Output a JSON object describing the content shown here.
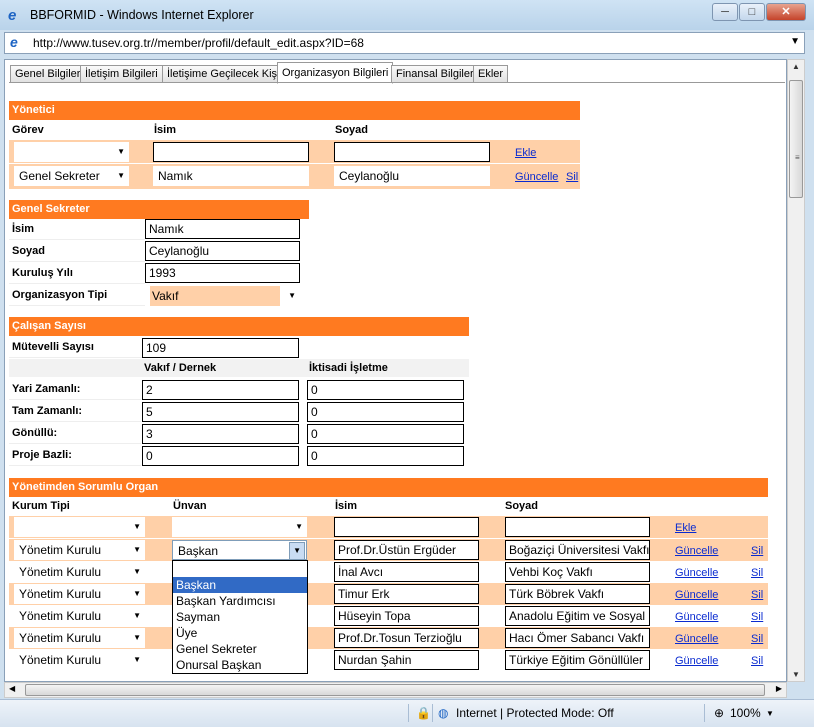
{
  "window": {
    "title": "BBFORMID - Windows Internet Explorer",
    "url": "http://www.tusev.org.tr//member/profil/default_edit.aspx?ID=68"
  },
  "tabs": [
    "Genel Bilgiler",
    "İletişim Bilgileri",
    "İletişime Geçilecek Kişi",
    "Organizasyon Bilgileri",
    "Finansal Bilgiler",
    "Ekler"
  ],
  "yonetici": {
    "title": "Yönetici",
    "col_gorev": "Görev",
    "col_isim": "İsim",
    "col_soyad": "Soyad",
    "add_link": "Ekle",
    "row": {
      "gorev": "Genel Sekreter",
      "isim": "Namık",
      "soyad": "Ceylanoğlu",
      "update": "Güncelle",
      "delete": "Sil"
    }
  },
  "genel_sekreter": {
    "title": "Genel Sekreter",
    "isim_label": "İsim",
    "isim": "Namık",
    "soyad_label": "Soyad",
    "soyad": "Ceylanoğlu",
    "kurulus_label": "Kuruluş Yılı",
    "kurulus": "1993",
    "tip_label": "Organizasyon Tipi",
    "tip": "Vakıf"
  },
  "calisan": {
    "title": "Çalışan Sayısı",
    "mutevelli_label": "Mütevelli Sayısı",
    "mutevelli": "109",
    "col1": "Vakıf / Dernek",
    "col2": "İktisadi İşletme",
    "rows": [
      {
        "label": "Yari Zamanlı:",
        "v1": "2",
        "v2": "0"
      },
      {
        "label": "Tam Zamanlı:",
        "v1": "5",
        "v2": "0"
      },
      {
        "label": "Gönüllü:",
        "v1": "3",
        "v2": "0"
      },
      {
        "label": "Proje Bazli:",
        "v1": "0",
        "v2": "0"
      }
    ]
  },
  "organ": {
    "title": "Yönetimden Sorumlu Organ",
    "col_kurum": "Kurum Tipi",
    "col_unvan": "Ünvan",
    "col_isim": "İsim",
    "col_soyad": "Soyad",
    "add_link": "Ekle",
    "update": "Güncelle",
    "delete": "Sil",
    "rows": [
      {
        "kurum": "Yönetim Kurulu",
        "unvan": "Başkan",
        "isim": "Prof.Dr.Üstün Ergüder",
        "soyad": "Boğaziçi Üniversitesi Vakfı"
      },
      {
        "kurum": "Yönetim Kurulu",
        "unvan": "",
        "isim": "İnal Avcı",
        "soyad": "Vehbi Koç Vakfı"
      },
      {
        "kurum": "Yönetim Kurulu",
        "unvan": "",
        "isim": "Timur Erk",
        "soyad": "Türk Böbrek Vakfı"
      },
      {
        "kurum": "Yönetim Kurulu",
        "unvan": "",
        "isim": "Hüseyin Topa",
        "soyad": "Anadolu Eğitim ve Sosyal"
      },
      {
        "kurum": "Yönetim Kurulu",
        "unvan": "",
        "isim": "Prof.Dr.Tosun Terzioğlu",
        "soyad": "Hacı Ömer Sabancı Vakfı"
      },
      {
        "kurum": "Yönetim Kurulu",
        "unvan": "",
        "isim": "Nurdan Şahin",
        "soyad": "Türkiye Eğitim Gönüllüler"
      }
    ],
    "dropdown": [
      "Başkan",
      "Başkan Yardımcısı",
      "Sayman",
      "Üye",
      "Genel Sekreter",
      "Onursal Başkan"
    ]
  },
  "status": {
    "zone": "Internet | Protected Mode: Off",
    "zoom": "100%"
  }
}
